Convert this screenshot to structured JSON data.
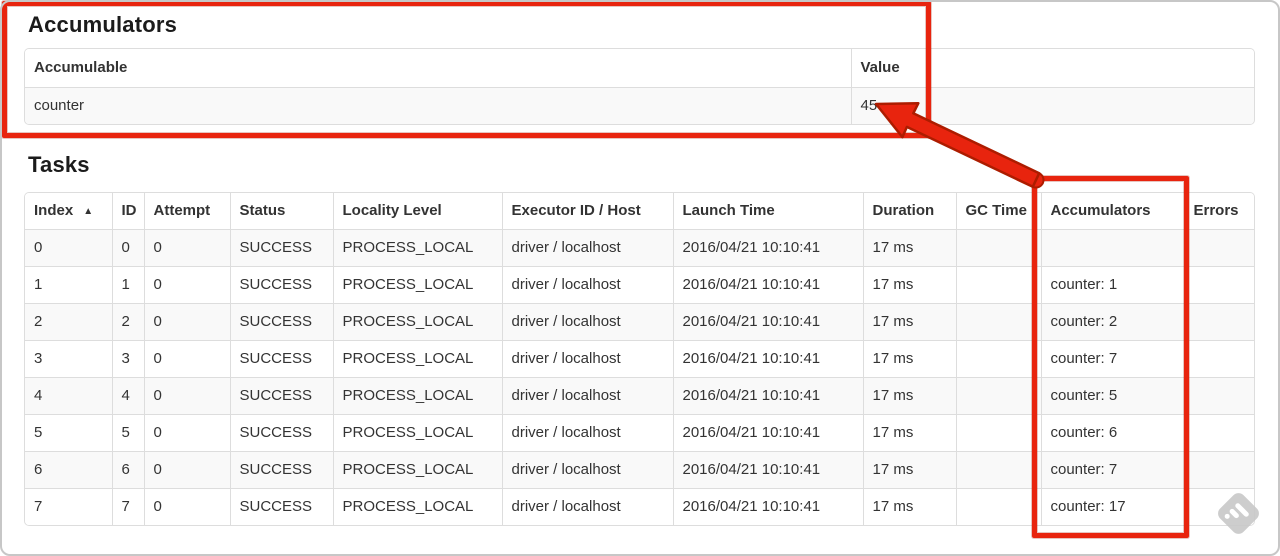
{
  "colors": {
    "annotation_red": "#e8240e",
    "annotation_red_outline": "#ad1c00",
    "stripe_row_bg": "#f9f9f9",
    "table_border": "#dddddd",
    "text": "#333333",
    "watermark_gray": "#c9c9c9"
  },
  "accumulators": {
    "heading": "Accumulators",
    "table": {
      "headers": [
        "Accumulable",
        "Value"
      ],
      "rows": [
        {
          "accumulable": "counter",
          "value": "45"
        }
      ]
    }
  },
  "tasks": {
    "heading": "Tasks",
    "headers": [
      "Index",
      "ID",
      "Attempt",
      "Status",
      "Locality Level",
      "Executor ID / Host",
      "Launch Time",
      "Duration",
      "GC Time",
      "Accumulators",
      "Errors"
    ],
    "sort_indicator": "▲",
    "row_keys": [
      "index",
      "id",
      "attempt",
      "status",
      "locality",
      "executor",
      "launch_time",
      "duration",
      "gc_time",
      "accumulators",
      "errors"
    ],
    "rows": [
      {
        "index": "0",
        "id": "0",
        "attempt": "0",
        "status": "SUCCESS",
        "locality": "PROCESS_LOCAL",
        "executor": "driver / localhost",
        "launch_time": "2016/04/21 10:10:41",
        "duration": "17 ms",
        "gc_time": "",
        "accumulators": "",
        "errors": ""
      },
      {
        "index": "1",
        "id": "1",
        "attempt": "0",
        "status": "SUCCESS",
        "locality": "PROCESS_LOCAL",
        "executor": "driver / localhost",
        "launch_time": "2016/04/21 10:10:41",
        "duration": "17 ms",
        "gc_time": "",
        "accumulators": "counter: 1",
        "errors": ""
      },
      {
        "index": "2",
        "id": "2",
        "attempt": "0",
        "status": "SUCCESS",
        "locality": "PROCESS_LOCAL",
        "executor": "driver / localhost",
        "launch_time": "2016/04/21 10:10:41",
        "duration": "17 ms",
        "gc_time": "",
        "accumulators": "counter: 2",
        "errors": ""
      },
      {
        "index": "3",
        "id": "3",
        "attempt": "0",
        "status": "SUCCESS",
        "locality": "PROCESS_LOCAL",
        "executor": "driver / localhost",
        "launch_time": "2016/04/21 10:10:41",
        "duration": "17 ms",
        "gc_time": "",
        "accumulators": "counter: 7",
        "errors": ""
      },
      {
        "index": "4",
        "id": "4",
        "attempt": "0",
        "status": "SUCCESS",
        "locality": "PROCESS_LOCAL",
        "executor": "driver / localhost",
        "launch_time": "2016/04/21 10:10:41",
        "duration": "17 ms",
        "gc_time": "",
        "accumulators": "counter: 5",
        "errors": ""
      },
      {
        "index": "5",
        "id": "5",
        "attempt": "0",
        "status": "SUCCESS",
        "locality": "PROCESS_LOCAL",
        "executor": "driver / localhost",
        "launch_time": "2016/04/21 10:10:41",
        "duration": "17 ms",
        "gc_time": "",
        "accumulators": "counter: 6",
        "errors": ""
      },
      {
        "index": "6",
        "id": "6",
        "attempt": "0",
        "status": "SUCCESS",
        "locality": "PROCESS_LOCAL",
        "executor": "driver / localhost",
        "launch_time": "2016/04/21 10:10:41",
        "duration": "17 ms",
        "gc_time": "",
        "accumulators": "counter: 7",
        "errors": ""
      },
      {
        "index": "7",
        "id": "7",
        "attempt": "0",
        "status": "SUCCESS",
        "locality": "PROCESS_LOCAL",
        "executor": "driver / localhost",
        "launch_time": "2016/04/21 10:10:41",
        "duration": "17 ms",
        "gc_time": "",
        "accumulators": "counter: 17",
        "errors": ""
      }
    ]
  }
}
